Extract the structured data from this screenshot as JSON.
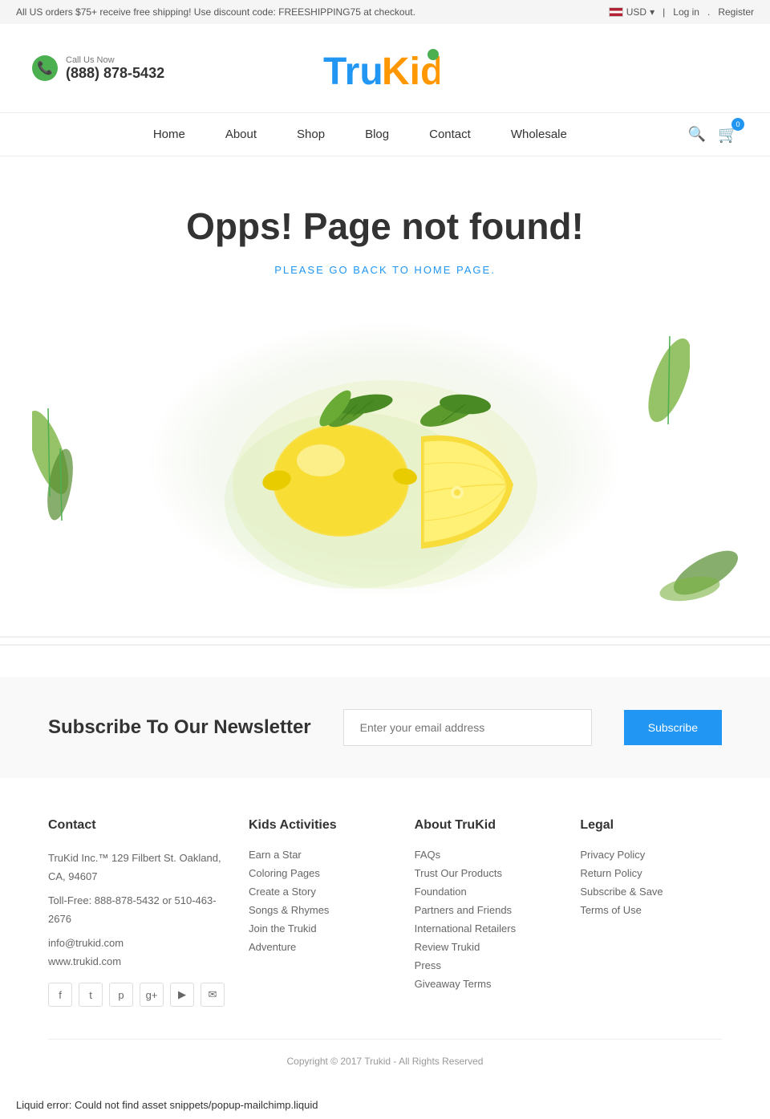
{
  "topbar": {
    "promo_text": "All US orders $75+ receive free shipping! Use discount code: FREESHIPPING75 at checkout.",
    "currency": "USD",
    "login_label": "Log in",
    "register_label": "Register"
  },
  "header": {
    "call_label": "Call Us Now",
    "phone": "(888) 878-5432",
    "logo_tru": "Tru",
    "logo_kid": "Kid"
  },
  "nav": {
    "items": [
      {
        "label": "Home",
        "id": "home"
      },
      {
        "label": "About",
        "id": "about"
      },
      {
        "label": "Shop",
        "id": "shop"
      },
      {
        "label": "Blog",
        "id": "blog"
      },
      {
        "label": "Contact",
        "id": "contact"
      },
      {
        "label": "Wholesale",
        "id": "wholesale"
      }
    ],
    "cart_count": "0"
  },
  "error_page": {
    "title": "Opps! Page not found!",
    "subtitle": "PLEASE GO BACK TO HOME PAGE."
  },
  "newsletter": {
    "title": "Subscribe To Our Newsletter",
    "placeholder": "Enter your email address",
    "button_label": "Subscribe"
  },
  "footer": {
    "contact": {
      "title": "Contact",
      "address": "TruKid Inc.™ 129 Filbert St. Oakland, CA, 94607",
      "tollfree": "Toll-Free: 888-878-5432 or 510-463-2676",
      "email": "info@trukid.com",
      "website": "www.trukid.com",
      "socials": [
        "f",
        "t",
        "p",
        "g+",
        "▶",
        "✉"
      ]
    },
    "kids_activities": {
      "title": "Kids Activities",
      "links": [
        "Earn a Star",
        "Coloring Pages",
        "Create a Story",
        "Songs & Rhymes",
        "Join the Trukid",
        "Adventure"
      ]
    },
    "about_trukid": {
      "title": "About TruKid",
      "links": [
        "FAQs",
        "Trust Our Products",
        "Foundation",
        "Partners and Friends",
        "International Retailers",
        "Review Trukid",
        "Press",
        "Giveaway Terms"
      ]
    },
    "legal": {
      "title": "Legal",
      "links": [
        "Privacy Policy",
        "Return Policy",
        "Subscribe & Save",
        "Terms of Use"
      ]
    },
    "copyright": "Copyright © 2017 Trukid - All Rights Reserved"
  },
  "liquid_error": {
    "text": "Liquid error: Could not find asset snippets/popup-mailchimp.liquid"
  }
}
